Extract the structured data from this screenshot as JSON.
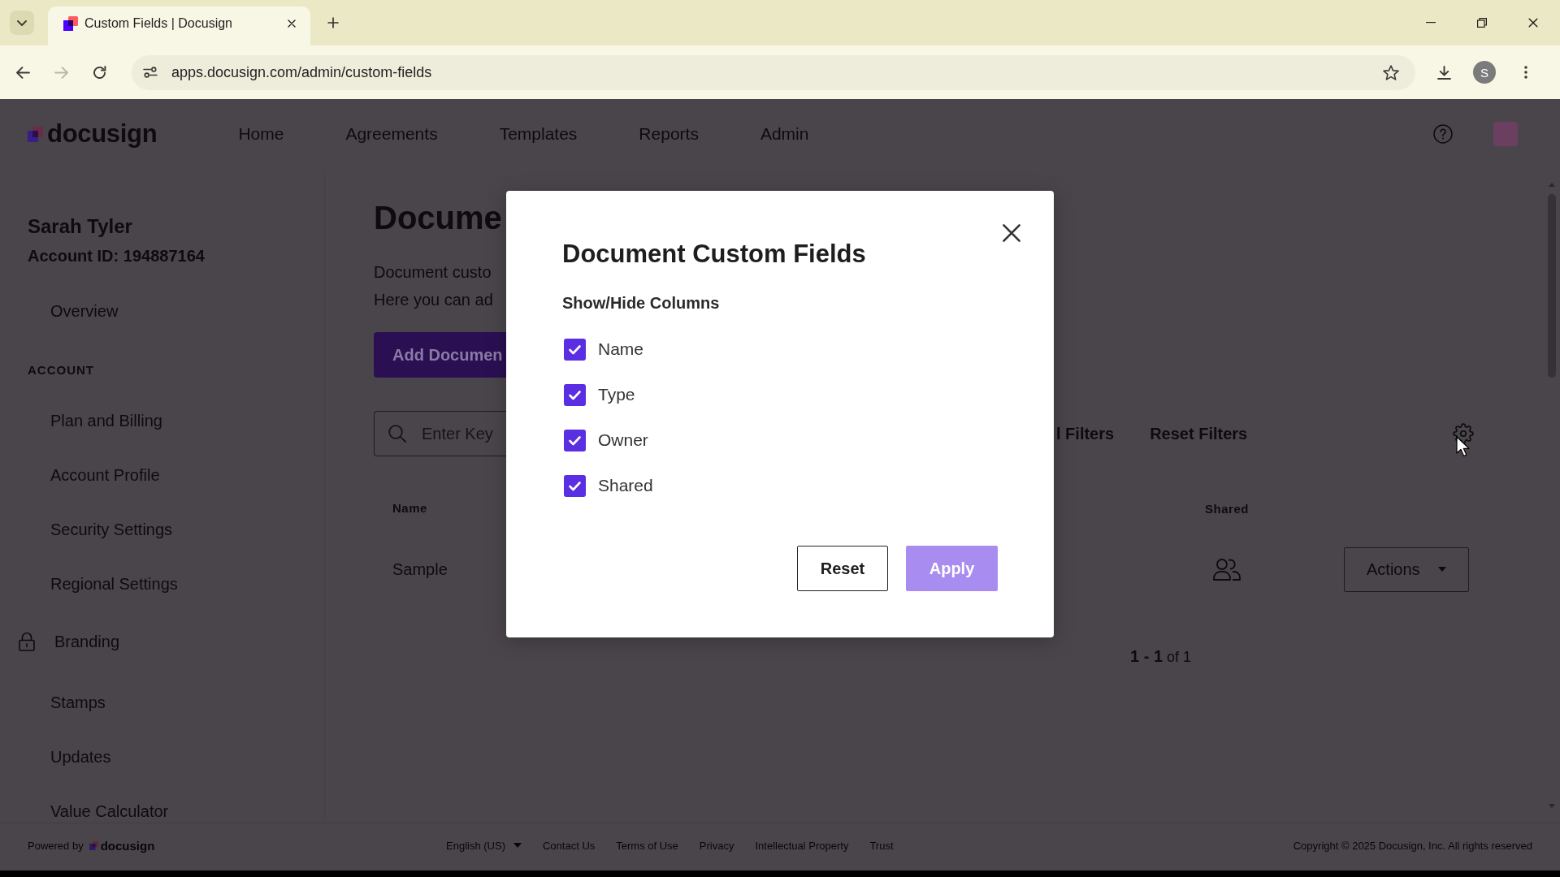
{
  "browser": {
    "tabs": [
      {
        "title": "Custom Fields | Docusign",
        "selected": true
      }
    ],
    "nav_buttons": [
      {
        "kind": "back",
        "disabled": false
      },
      {
        "kind": "forward",
        "disabled": true
      },
      {
        "kind": "reload",
        "disabled": false
      }
    ],
    "url": "apps.docusign.com/admin/custom-fields",
    "profile_initial": "S"
  },
  "header": {
    "logo": "docusign",
    "nav": [
      "Home",
      "Agreements",
      "Templates",
      "Reports",
      "Admin"
    ]
  },
  "sidebar": {
    "user_name": "Sarah Tyler",
    "account_id": "Account ID: 194887164",
    "items": [
      {
        "kind": "link",
        "label": "Overview"
      },
      {
        "kind": "section",
        "label": "ACCOUNT"
      },
      {
        "kind": "link",
        "label": "Plan and Billing"
      },
      {
        "kind": "link",
        "label": "Account Profile"
      },
      {
        "kind": "link",
        "label": "Security Settings"
      },
      {
        "kind": "link",
        "label": "Regional Settings"
      },
      {
        "kind": "locked",
        "label": "Branding"
      },
      {
        "kind": "link",
        "label": "Stamps"
      },
      {
        "kind": "link",
        "label": "Updates"
      },
      {
        "kind": "link",
        "label": "Value Calculator"
      }
    ]
  },
  "page": {
    "title": "Docume",
    "description": [
      "Document custo",
      "Here you can ad"
    ],
    "add_button": "Add Documen",
    "search": {
      "placeholder": "Enter Key"
    },
    "filter_links": [
      "l Filters",
      "Reset Filters"
    ],
    "table": {
      "columns": [
        "Name",
        "Shared"
      ],
      "rows": [
        {
          "name": "Sample",
          "action": "Actions"
        }
      ]
    },
    "pagination": "**1 - 1** of 1"
  },
  "modal": {
    "title": "Document Custom Fields",
    "subtitle": "Show/Hide Columns",
    "options": [
      {
        "label": "Name",
        "checked": true
      },
      {
        "label": "Type",
        "checked": true
      },
      {
        "label": "Owner",
        "checked": true
      },
      {
        "label": "Shared",
        "checked": true
      }
    ],
    "buttons": [
      {
        "kind": "secondary",
        "label": "Reset",
        "disabled": false
      },
      {
        "kind": "primary",
        "label": "Apply",
        "disabled": true
      }
    ]
  },
  "footer": {
    "powered_by": "Powered by",
    "logo": "docusign",
    "language": "English (US)",
    "links": [
      "Contact Us",
      "Terms of Use",
      "Privacy",
      "Intellectual Property",
      "Trust"
    ],
    "copyright": "Copyright © 2025 Docusign, Inc. All rights reserved"
  }
}
